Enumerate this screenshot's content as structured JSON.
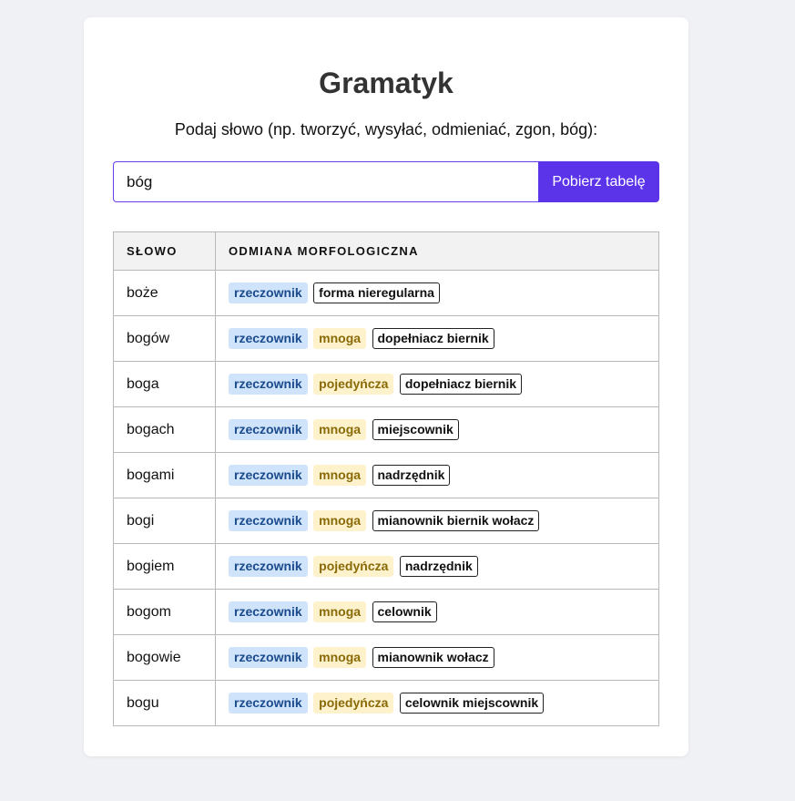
{
  "app": {
    "title": "Gramatyk",
    "prompt": "Podaj słowo (np. tworzyć, wysyłać, odmieniać, zgon, bóg):"
  },
  "search": {
    "value": "bóg",
    "button_label": "Pobierz tabelę"
  },
  "table": {
    "headers": [
      "SŁOWO",
      "ODMIANA MORFOLOGICZNA"
    ],
    "rows": [
      {
        "word": "boże",
        "pos": "rzeczownik",
        "number": "",
        "case": "forma nieregularna"
      },
      {
        "word": "bogów",
        "pos": "rzeczownik",
        "number": "mnoga",
        "case": "dopełniacz biernik"
      },
      {
        "word": "boga",
        "pos": "rzeczownik",
        "number": "pojedyńcza",
        "case": "dopełniacz biernik"
      },
      {
        "word": "bogach",
        "pos": "rzeczownik",
        "number": "mnoga",
        "case": "miejscownik"
      },
      {
        "word": "bogami",
        "pos": "rzeczownik",
        "number": "mnoga",
        "case": "nadrzędnik"
      },
      {
        "word": "bogi",
        "pos": "rzeczownik",
        "number": "mnoga",
        "case": "mianownik biernik wołacz"
      },
      {
        "word": "bogiem",
        "pos": "rzeczownik",
        "number": "pojedyńcza",
        "case": "nadrzędnik"
      },
      {
        "word": "bogom",
        "pos": "rzeczownik",
        "number": "mnoga",
        "case": "celownik"
      },
      {
        "word": "bogowie",
        "pos": "rzeczownik",
        "number": "mnoga",
        "case": "mianownik wołacz"
      },
      {
        "word": "bogu",
        "pos": "rzeczownik",
        "number": "pojedyńcza",
        "case": "celownik miejscownik"
      }
    ]
  },
  "colors": {
    "accent": "#5b34ea",
    "pos_tag_bg": "#cfe3fb",
    "number_tag_bg": "#fdf2cc",
    "page_bg": "#f0f1f4"
  }
}
